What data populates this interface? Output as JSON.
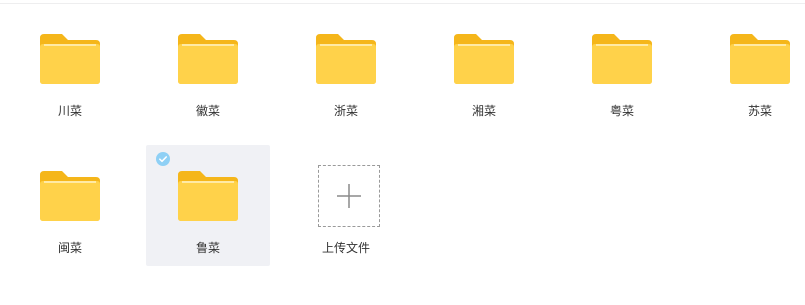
{
  "folders_row1": [
    {
      "label": "川菜",
      "icon": "folder-icon"
    },
    {
      "label": "徽菜",
      "icon": "folder-icon"
    },
    {
      "label": "浙菜",
      "icon": "folder-icon"
    },
    {
      "label": "湘菜",
      "icon": "folder-icon"
    },
    {
      "label": "粤菜",
      "icon": "folder-icon"
    },
    {
      "label": "苏菜",
      "icon": "folder-icon"
    }
  ],
  "folders_row2": [
    {
      "label": "闽菜",
      "icon": "folder-icon",
      "selected": false
    },
    {
      "label": "鲁菜",
      "icon": "folder-icon",
      "selected": true
    }
  ],
  "upload": {
    "label": "上传文件",
    "icon": "plus-icon"
  },
  "colors": {
    "folder_back": "#f5b61a",
    "folder_front": "#ffd24a",
    "selected_bg": "#f0f1f5",
    "check": "#8fd0f5"
  }
}
